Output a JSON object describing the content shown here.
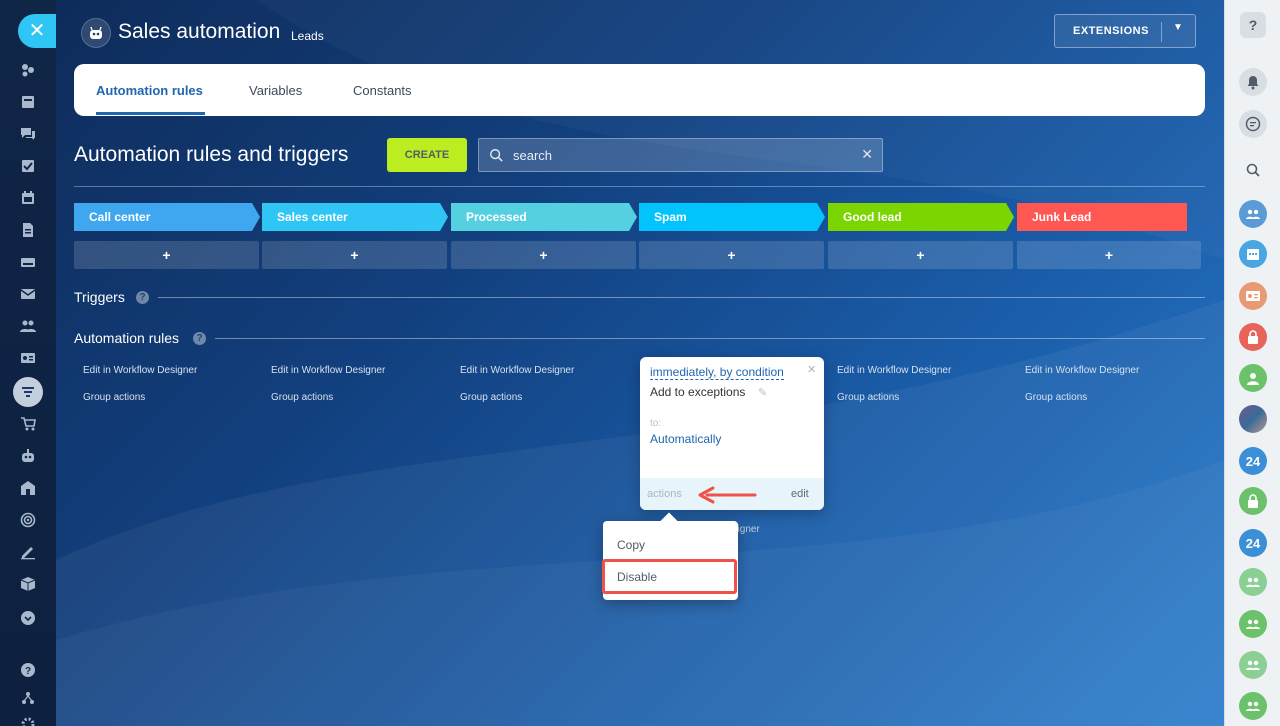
{
  "header": {
    "title": "Sales automation",
    "subtitle": "Leads",
    "extensions_label": "EXTENSIONS"
  },
  "tabs": [
    {
      "label": "Automation rules",
      "active": true
    },
    {
      "label": "Variables",
      "active": false
    },
    {
      "label": "Constants",
      "active": false
    }
  ],
  "toolbar": {
    "section_title": "Automation rules and triggers",
    "create_label": "CREATE",
    "search_placeholder": "search"
  },
  "stages": [
    {
      "label": "Call center",
      "color": "#3fa7f0"
    },
    {
      "label": "Sales center",
      "color": "#2fc6f6"
    },
    {
      "label": "Processed",
      "color": "#55d0e0"
    },
    {
      "label": "Spam",
      "color": "#00c4fb"
    },
    {
      "label": "Good lead",
      "color": "#7bd500"
    },
    {
      "label": "Junk Lead",
      "color": "#ff5752"
    }
  ],
  "add_symbol": "+",
  "sections": {
    "triggers": "Triggers",
    "automation_rules": "Automation rules",
    "help_symbol": "?"
  },
  "column_links": {
    "edit_designer": "Edit in Workflow Designer",
    "group_actions": "Group actions",
    "partial_designer": "esigner"
  },
  "rule_card": {
    "condition": "immediately, by condition",
    "title": "Add to exceptions",
    "to_label": "to:",
    "to_value": "Automatically",
    "actions_label": "actions",
    "edit_label": "edit"
  },
  "popup_menu": {
    "items": [
      "Copy",
      "Disable"
    ],
    "highlighted": "Disable"
  },
  "right_sidebar": {
    "help": "?",
    "badge_24": "24"
  },
  "colors": {
    "accent_blue": "#2066b0",
    "create_green": "#bbed21",
    "highlight_red": "#f0524a",
    "sidebar_cyan": "#2fc6f6"
  }
}
